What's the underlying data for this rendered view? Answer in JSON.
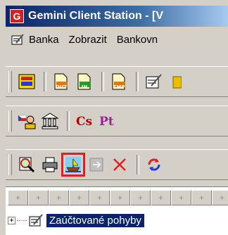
{
  "window": {
    "title": "Gemini Client Station - [V",
    "app_icon_letter": "G"
  },
  "menu": {
    "items": [
      "Banka",
      "Zobrazit",
      "Bankovn"
    ]
  },
  "toolbar1": {
    "icon_labels": [
      "OUT",
      "IN",
      "TMP"
    ]
  },
  "toolbar2": {
    "cs_label": "Cs",
    "pt_label": "Pt"
  },
  "tree": {
    "expander": "+",
    "header_marker": "+",
    "node_label": "Zaúčtované pohyby"
  },
  "colors": {
    "titlebar": "#0a246a",
    "selection": "#0a246a",
    "highlight_frame": "#e02020",
    "cs_red": "#c00000",
    "pt_purple": "#a020a0"
  }
}
